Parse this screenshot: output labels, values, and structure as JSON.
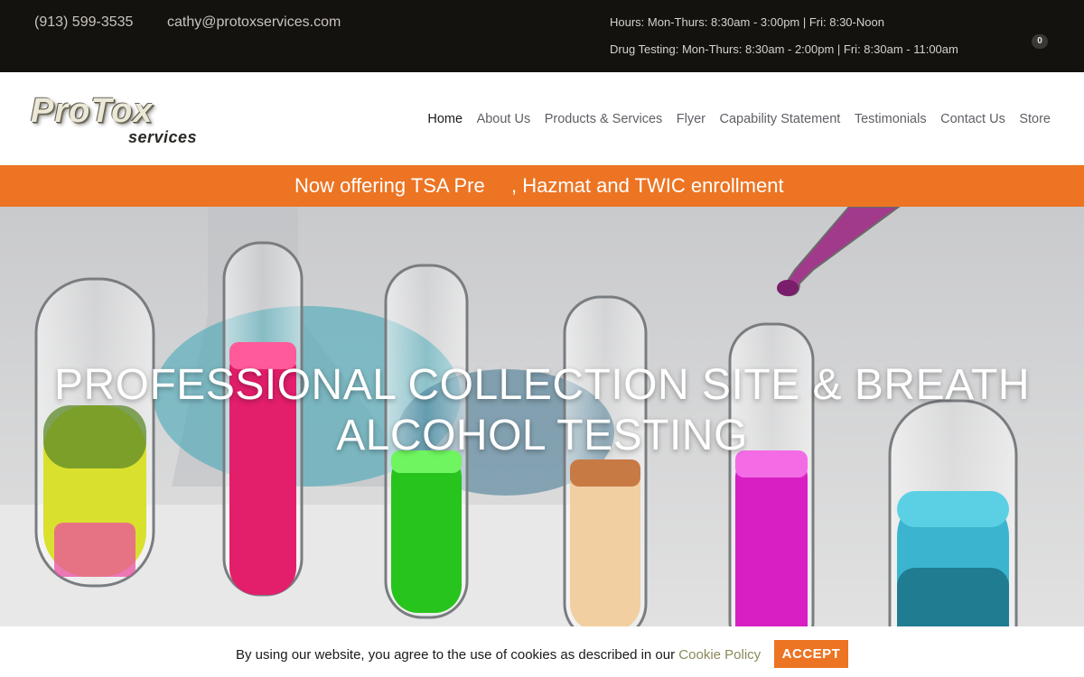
{
  "topbar": {
    "phone": "(913) 599-3535",
    "email": "cathy@protoxservices.com",
    "hours": "Hours: Mon-Thurs: 8:30am - 3:00pm | Fri: 8:30-Noon",
    "drug_testing": "Drug Testing: Mon-Thurs: 8:30am - 2:00pm | Fri: 8:30am - 11:00am",
    "cart_count": "0"
  },
  "logo": {
    "line1": "ProTox",
    "line2": "services"
  },
  "nav": {
    "items": [
      {
        "label": "Home",
        "active": true
      },
      {
        "label": "About Us"
      },
      {
        "label": "Products & Services"
      },
      {
        "label": "Flyer"
      },
      {
        "label": "Capability Statement"
      },
      {
        "label": "Testimonials"
      },
      {
        "label": "Contact Us"
      },
      {
        "label": "Store"
      }
    ]
  },
  "promo": {
    "text_before": "Now offering TSA Pre",
    "text_after": ", Hazmat and TWIC enrollment"
  },
  "hero": {
    "title_line1": "PROFESSIONAL COLLECTION SITE & BREATH",
    "title_line2": "ALCOHOL TESTING"
  },
  "cookie": {
    "message": "By using our website, you agree to the use of cookies as described in our",
    "policy_link": "Cookie Policy",
    "accept_label": "ACCEPT"
  },
  "colors": {
    "accent": "#ec7423",
    "topbar_bg": "#14120f"
  }
}
